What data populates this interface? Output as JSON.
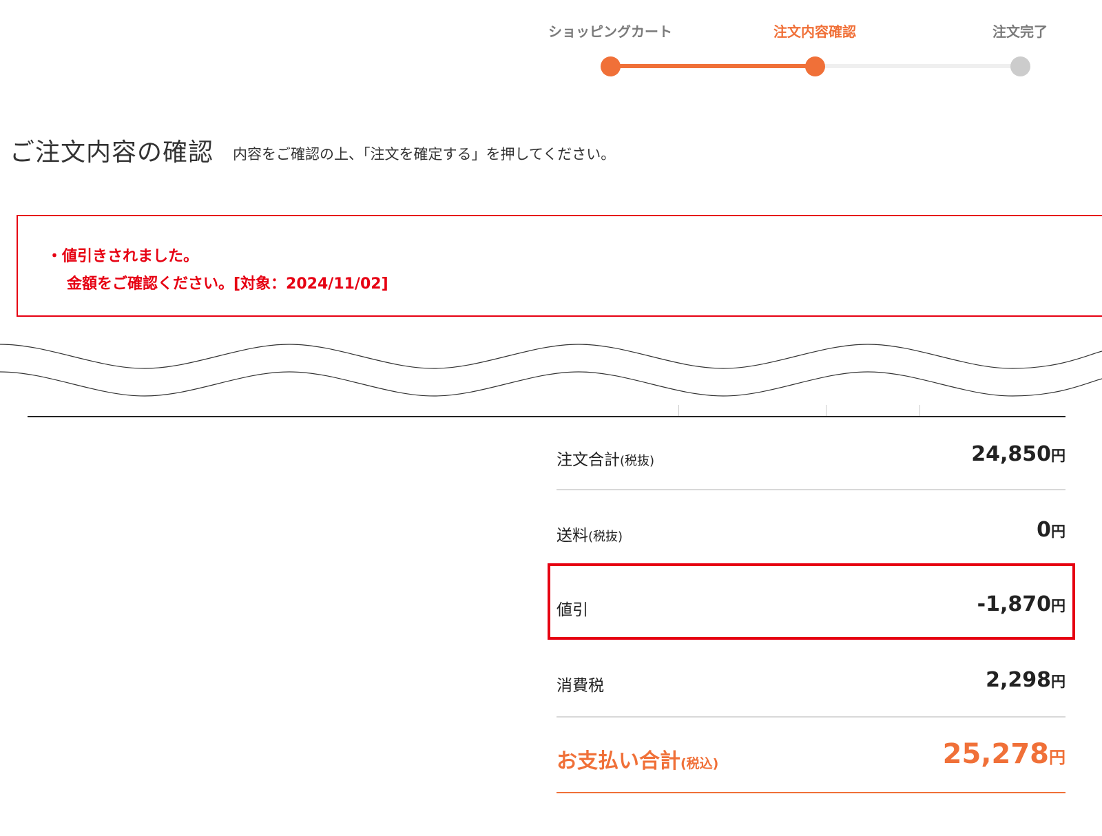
{
  "stepper": {
    "steps": [
      {
        "label": "ショッピングカート",
        "state": "done"
      },
      {
        "label": "注文内容確認",
        "state": "current"
      },
      {
        "label": "注文完了",
        "state": "todo"
      }
    ],
    "colors": {
      "active": "#f07038",
      "inactive": "#cccccc",
      "track": "#efefef",
      "done_text": "#7a7a7a"
    }
  },
  "heading": {
    "title": "ご注文内容の確認",
    "subtitle": "内容をご確認の上、「注文を確定する」を押してください。"
  },
  "alert": {
    "line1": "・値引きされました。",
    "line2": "金額をご確認ください。[対象：2024/11/02]",
    "color": "#e60012"
  },
  "summary": {
    "rows": [
      {
        "label": "注文合計",
        "note": "(税抜)",
        "value": "24,850",
        "unit": "円"
      },
      {
        "label": "送料",
        "note": "(税抜)",
        "value": "0",
        "unit": "円"
      },
      {
        "label": "値引",
        "note": "",
        "value": "-1,870",
        "unit": "円"
      },
      {
        "label": "消費税",
        "note": "",
        "value": "2,298",
        "unit": "円"
      }
    ],
    "total": {
      "label": "お支払い合計",
      "note": "(税込)",
      "value": "25,278",
      "unit": "円",
      "color": "#f07038"
    }
  }
}
